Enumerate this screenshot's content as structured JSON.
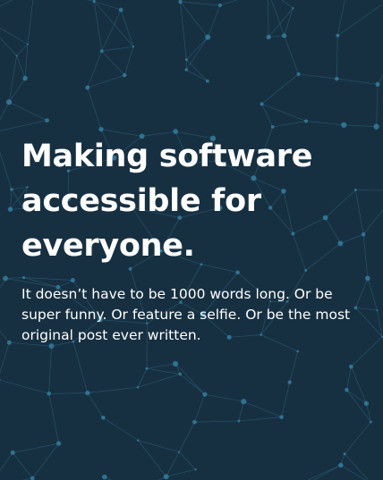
{
  "hero": {
    "title_lines": [
      "Making software",
      "accessible for",
      "everyone."
    ],
    "body": "It doesn’t have to be 1000 words long. Or be super funny. Or feature a selfie. Or be the most original post ever written.",
    "background_color": "#173041",
    "pattern_line_color": "#2f6d8c",
    "pattern_dot_color": "#3a84a6",
    "text_color": "#ffffff"
  }
}
